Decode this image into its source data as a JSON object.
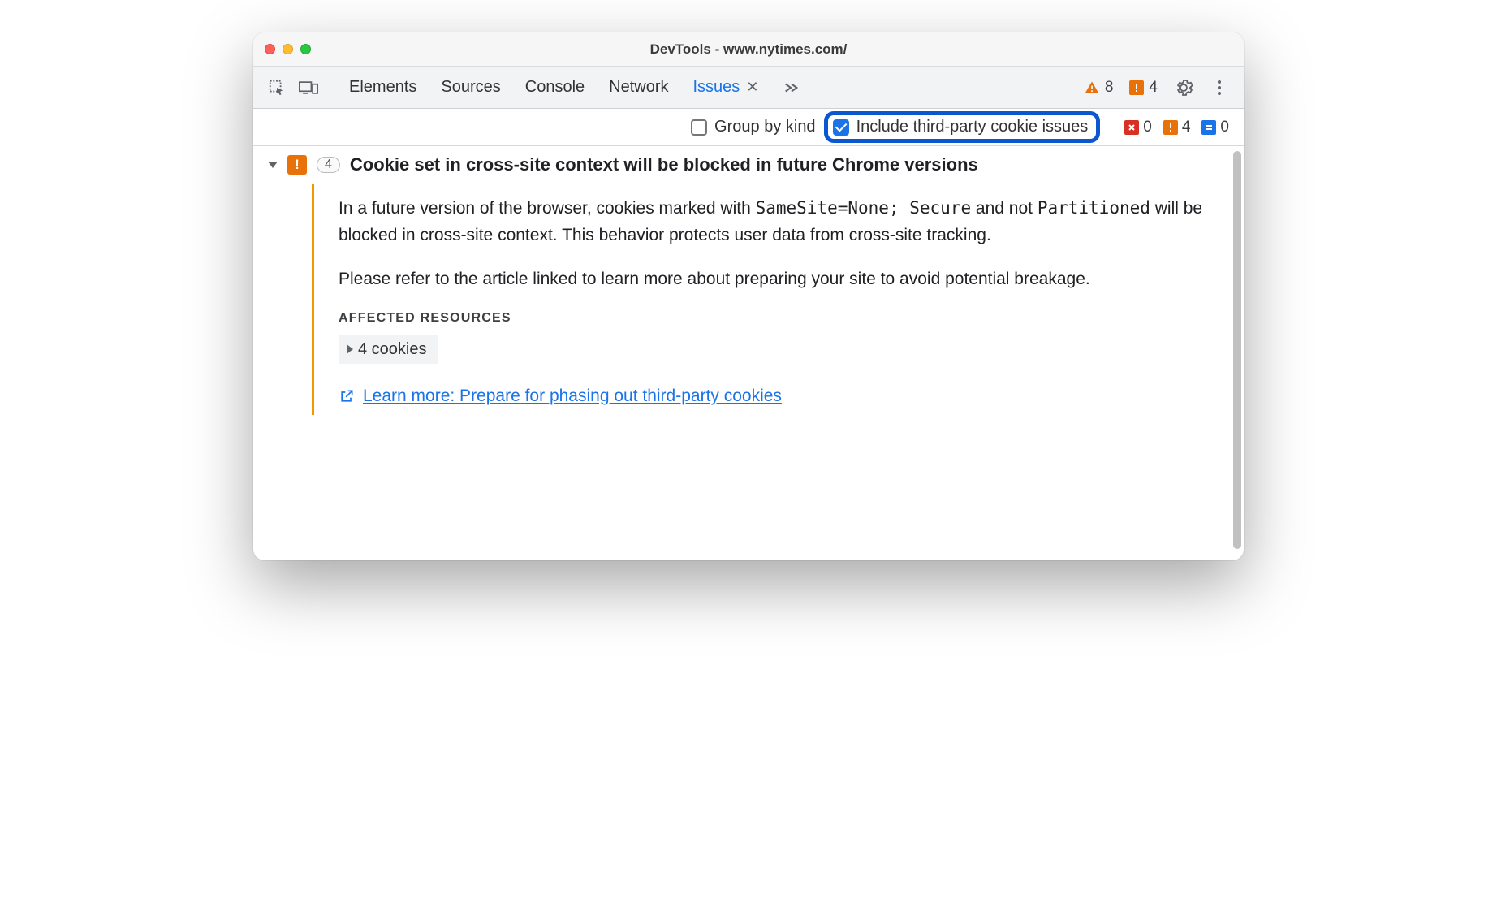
{
  "window": {
    "title": "DevTools - www.nytimes.com/"
  },
  "toolbar": {
    "tabs": [
      {
        "label": "Elements"
      },
      {
        "label": "Sources"
      },
      {
        "label": "Console"
      },
      {
        "label": "Network"
      },
      {
        "label": "Issues",
        "active": true
      }
    ],
    "error_count": "8",
    "warn_count": "4"
  },
  "filter": {
    "group_by_kind_label": "Group by kind",
    "include_third_party_label": "Include third-party cookie issues",
    "counts": {
      "error": "0",
      "warn": "4",
      "info": "0"
    }
  },
  "issue": {
    "count": "4",
    "title": "Cookie set in cross-site context will be blocked in future Chrome versions",
    "para1_a": "In a future version of the browser, cookies marked with ",
    "para1_code1": "SameSite=None; Secure",
    "para1_b": " and not ",
    "para1_code2": "Partitioned",
    "para1_c": " will be blocked in cross-site context. This behavior protects user data from cross-site tracking.",
    "para2": "Please refer to the article linked to learn more about preparing your site to avoid potential breakage.",
    "affected_heading": "AFFECTED RESOURCES",
    "resources_label": "4 cookies",
    "learn_more": "Learn more: Prepare for phasing out third-party cookies"
  }
}
